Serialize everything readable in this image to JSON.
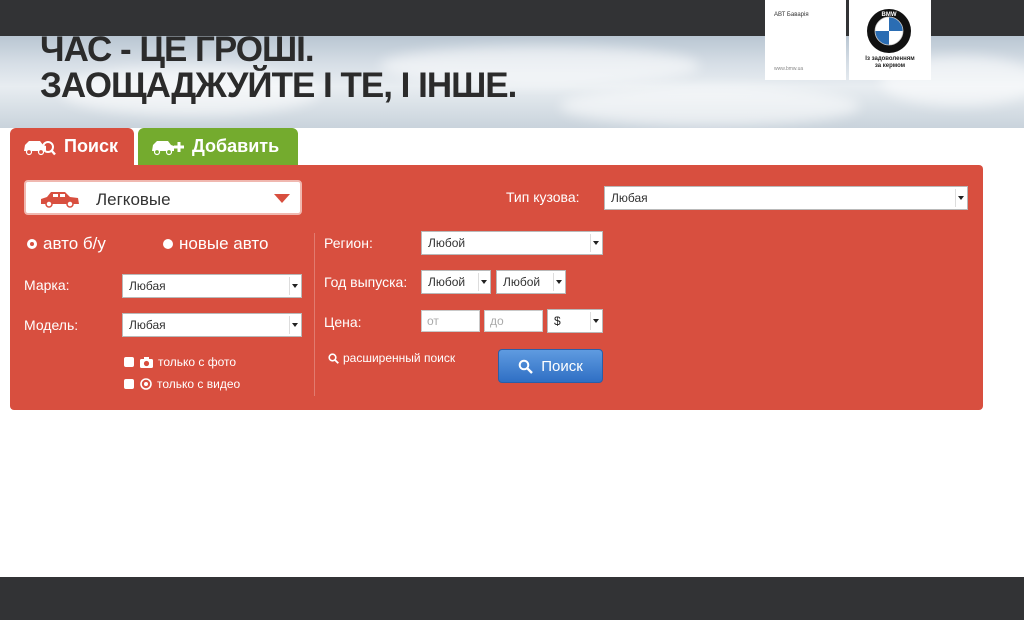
{
  "banner": {
    "headline_line1": "ЧАС - ЦЕ ГРОШІ.",
    "headline_line2": "ЗАОЩАДЖУЙТЕ І ТЕ, І ІНШЕ.",
    "ad_title": "АВТ Баварія",
    "ad_url": "www.bmw.ua",
    "bmw_letters": "BMW",
    "bmw_caption_line1": "Із задоволенням",
    "bmw_caption_line2": "за кермом"
  },
  "tabs": [
    {
      "label": "Поиск",
      "icon": "car-search-icon",
      "color": "#d84f3f",
      "active": true
    },
    {
      "label": "Добавить",
      "icon": "car-add-icon",
      "color": "#74ab2e",
      "active": false
    }
  ],
  "form": {
    "category": {
      "value": "Легковые",
      "icon": "car-icon"
    },
    "condition": [
      {
        "label": "авто б/у",
        "checked": true
      },
      {
        "label": "новые авто",
        "checked": false
      }
    ],
    "make": {
      "label": "Марка:",
      "value": "Любая"
    },
    "model": {
      "label": "Модель:",
      "value": "Любая"
    },
    "only_photo": {
      "label": "только с фото",
      "icon": "camera-icon",
      "checked": false
    },
    "only_video": {
      "label": "только с видео",
      "icon": "play-icon",
      "checked": false
    },
    "body_type": {
      "label": "Тип кузова:",
      "value": "Любая"
    },
    "region": {
      "label": "Регион:",
      "value": "Любой"
    },
    "year": {
      "label": "Год выпуска:",
      "from": "Любой",
      "to": "Любой"
    },
    "price": {
      "label": "Цена:",
      "from_placeholder": "от",
      "to_placeholder": "до",
      "currency": "$"
    },
    "advanced_link": "расширенный поиск",
    "search_button": "Поиск"
  },
  "colors": {
    "panel": "#d84f3f",
    "add_tab": "#74ab2e",
    "search_button": "#3a7bd5",
    "dark_bar": "#323335"
  }
}
